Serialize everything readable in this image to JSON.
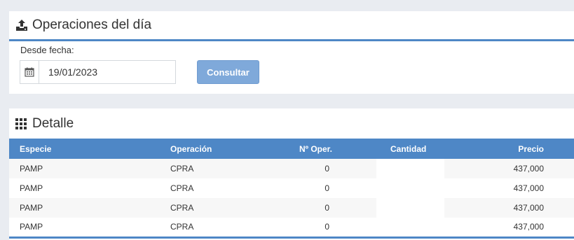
{
  "operations_panel": {
    "title": "Operaciones del día",
    "icon": "upload-tray-icon",
    "date_label": "Desde fecha:",
    "date_icon": "calendar-icon",
    "date_value": "19/01/2023",
    "submit_label": "Consultar"
  },
  "detail_panel": {
    "title": "Detalle",
    "icon": "grid-icon",
    "columns": [
      "Especie",
      "Operación",
      "Nº Oper.",
      "Cantidad",
      "Precio"
    ],
    "rows": [
      {
        "especie": "PAMP",
        "operacion": "CPRA",
        "noper": "0",
        "cantidad": "",
        "precio": "437,000"
      },
      {
        "especie": "PAMP",
        "operacion": "CPRA",
        "noper": "0",
        "cantidad": "",
        "precio": "437,000"
      },
      {
        "especie": "PAMP",
        "operacion": "CPRA",
        "noper": "0",
        "cantidad": "",
        "precio": "437,000"
      },
      {
        "especie": "PAMP",
        "operacion": "CPRA",
        "noper": "0",
        "cantidad": "",
        "precio": "437,000"
      }
    ]
  },
  "colors": {
    "accent": "#4e87c6",
    "button": "#7fa9da",
    "background": "#e9ecf1"
  }
}
